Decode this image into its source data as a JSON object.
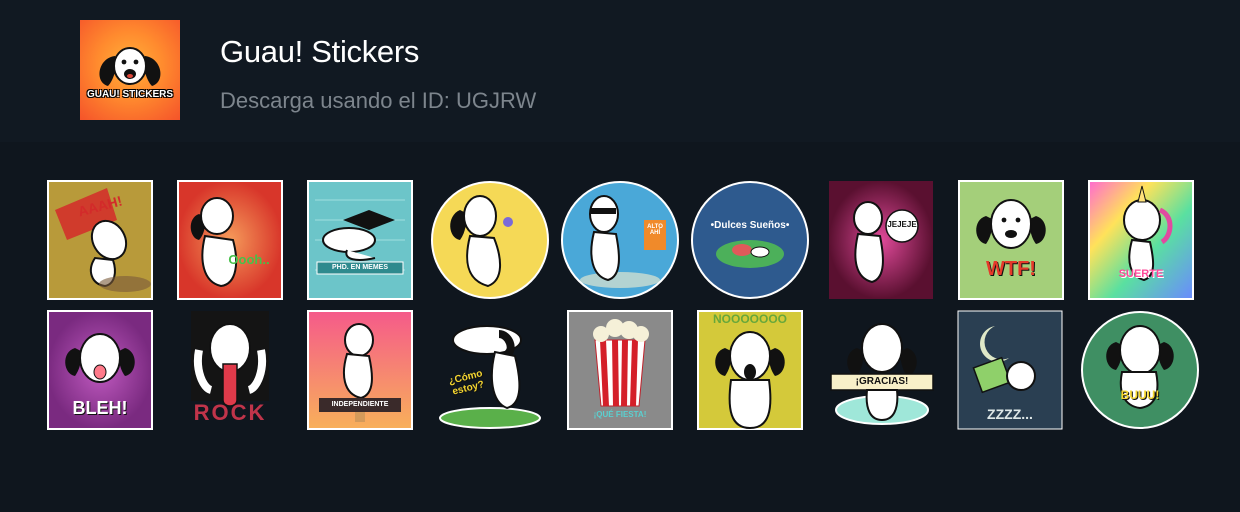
{
  "pack": {
    "title": "Guau! Stickers",
    "subtitle": "Descarga usando el ID: UGJRW",
    "logo_text": "GUAU! STICKERS"
  },
  "stickers": [
    {
      "name": "aah",
      "caption": "AAAH!",
      "bg": "#b89a3a"
    },
    {
      "name": "oooh",
      "caption": "Oooh..",
      "bg": "#e14a2b"
    },
    {
      "name": "phd-en-memes",
      "caption": "PHD. EN MEMES",
      "bg": "#6cc5c9"
    },
    {
      "name": "flower",
      "caption": "",
      "bg": "#f5d956"
    },
    {
      "name": "alto-ahi",
      "caption": "ALTO AHÍ",
      "bg": "#4aa8d8"
    },
    {
      "name": "dulces-suenos",
      "caption": "•Dulces Sueños•",
      "bg": "#2e5a8e"
    },
    {
      "name": "jejeje",
      "caption": "JEJEJE",
      "bg": "#b02a6a"
    },
    {
      "name": "wtf",
      "caption": "WTF!",
      "bg": "#a4cf7a"
    },
    {
      "name": "suerte",
      "caption": "SUERTE",
      "bg": "#d86be0"
    },
    {
      "name": "bleh",
      "caption": "BLEH!",
      "bg": "#9c3a9a"
    },
    {
      "name": "rock",
      "caption": "ROCK",
      "bg": "#101010"
    },
    {
      "name": "independiente",
      "caption": "INDEPENDIENTE",
      "bg": "#f35a7a"
    },
    {
      "name": "como-estoy",
      "caption": "¿Cómo estoy?",
      "bg": "#5ab04a"
    },
    {
      "name": "popcorn",
      "caption": "¡QUÉ FIESTA!",
      "bg": "#8a8a8a"
    },
    {
      "name": "noooo",
      "caption": "NOOOOOOO",
      "bg": "#d4c93a"
    },
    {
      "name": "gracias",
      "caption": "¡GRACIAS!",
      "bg": "#9fe7d9"
    },
    {
      "name": "zzzz",
      "caption": "ZZZZ...",
      "bg": "#2a3f52"
    },
    {
      "name": "buuu",
      "caption": "BUUU!",
      "bg": "#3f8f63"
    }
  ]
}
